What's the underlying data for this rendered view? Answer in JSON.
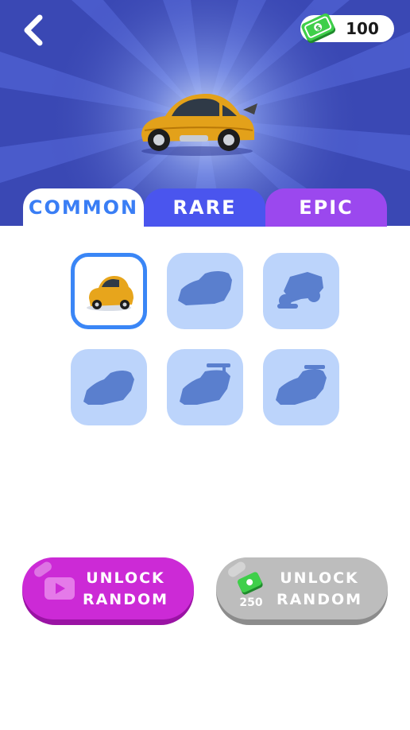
{
  "header": {
    "back_icon": "chevron-left-icon",
    "currency": {
      "icon": "cash-icon",
      "amount": "100"
    }
  },
  "preview": {
    "car": "yellow-beetle-hotrod"
  },
  "tabs": [
    {
      "label": "COMMON",
      "active": true,
      "color": "#ffffff",
      "text_color": "#3a7ef5"
    },
    {
      "label": "RARE",
      "active": false,
      "color": "#4a55ee"
    },
    {
      "label": "EPIC",
      "active": false,
      "color": "#9b48ee"
    }
  ],
  "grid": {
    "slots": [
      {
        "state": "unlocked",
        "selected": true,
        "car": "yellow-beetle"
      },
      {
        "state": "locked",
        "selected": false,
        "car": "sedan-silhouette"
      },
      {
        "state": "locked",
        "selected": false,
        "car": "buggy-silhouette"
      },
      {
        "state": "locked",
        "selected": false,
        "car": "coupe-silhouette"
      },
      {
        "state": "locked",
        "selected": false,
        "car": "spoiler-car-silhouette"
      },
      {
        "state": "locked",
        "selected": false,
        "car": "sports-car-silhouette"
      }
    ]
  },
  "actions": {
    "video_unlock": {
      "line1": "UNLOCK",
      "line2": "RANDOM",
      "icon": "video-play-icon"
    },
    "coin_unlock": {
      "line1": "UNLOCK",
      "line2": "RANDOM",
      "icon": "cash-icon",
      "price": "250"
    }
  },
  "colors": {
    "hero_background": "#3a48b4",
    "slot_locked": "#bcd4fb",
    "slot_selected_border": "#3a86f6",
    "video_button": "#cc2ad6",
    "coin_button": "#bdbdbd"
  }
}
